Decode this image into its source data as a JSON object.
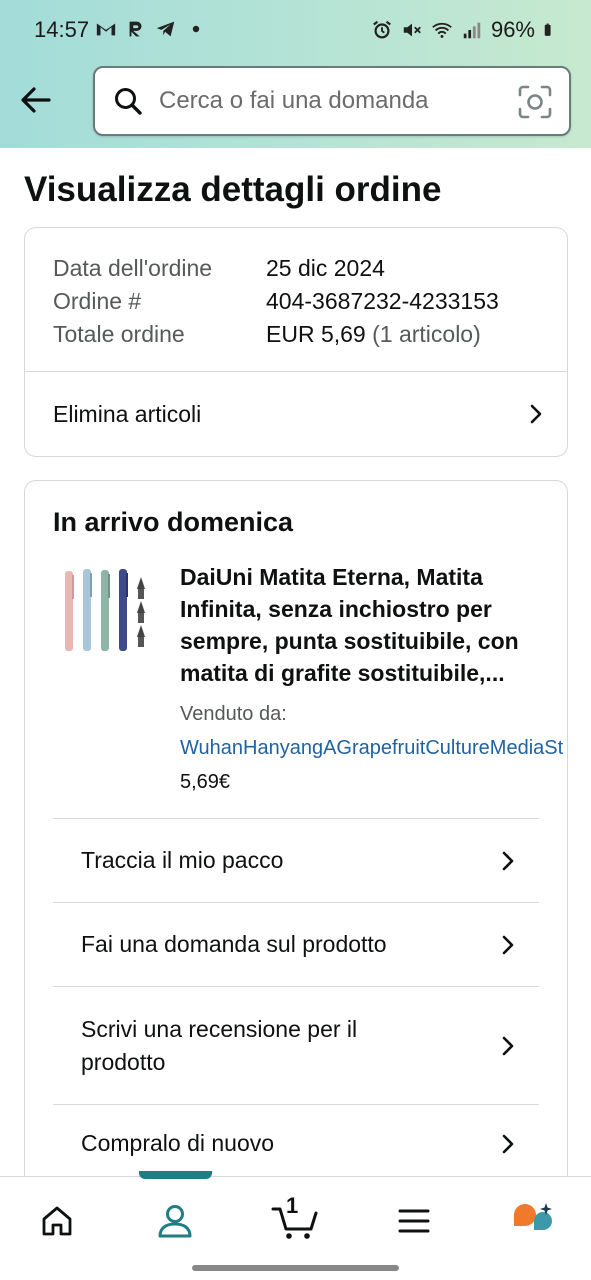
{
  "status_bar": {
    "time": "14:57",
    "battery": "96%",
    "icons": [
      "gmail-icon",
      "r-app-icon",
      "telegram-icon",
      "dot-icon",
      "alarm-icon",
      "mute-icon",
      "wifi-icon",
      "signal-icon",
      "battery-icon"
    ]
  },
  "header": {
    "back_icon": "arrow-left-icon",
    "search": {
      "placeholder": "Cerca o fai una domanda",
      "value": ""
    },
    "camera_icon": "camera-scan-icon"
  },
  "page": {
    "title": "Visualizza dettagli ordine"
  },
  "order_info": {
    "rows": [
      {
        "label": "Data dell'ordine",
        "value": "25 dic 2024",
        "extra": ""
      },
      {
        "label": "Ordine #",
        "value": "404-3687232-4233153",
        "extra": ""
      },
      {
        "label": "Totale ordine",
        "value": "EUR 5,69",
        "extra": " (1 articolo)"
      }
    ],
    "delete_items_label": "Elimina articoli"
  },
  "shipment": {
    "arrival_label": "In arrivo domenica",
    "product": {
      "title": "DaiUni Matita Eterna, Matita Infinita, senza inchiostro per sempre, punta sostituibile, con matita di grafite sostituibile,...",
      "seller_label": "Venduto da:",
      "seller_name": "WuhanHanyangAGrapefruitCultureMediaSt",
      "price": "5,69€",
      "pencil_colors": [
        "#e8b7b4",
        "#a9c6d9",
        "#8fb5a6",
        "#3e4a8a"
      ]
    },
    "actions": [
      {
        "label": "Traccia il mio pacco"
      },
      {
        "label": "Fai una domanda sul prodotto"
      },
      {
        "label": "Scrivi una recensione per il prodotto"
      },
      {
        "label": "Compralo di nuovo"
      }
    ]
  },
  "bottom_nav": {
    "items": [
      "home-icon",
      "account-icon",
      "cart-icon",
      "menu-icon",
      "rufus-icon"
    ],
    "cart_count": "1",
    "active_index": 1,
    "accent_color": "#1f7d83"
  }
}
